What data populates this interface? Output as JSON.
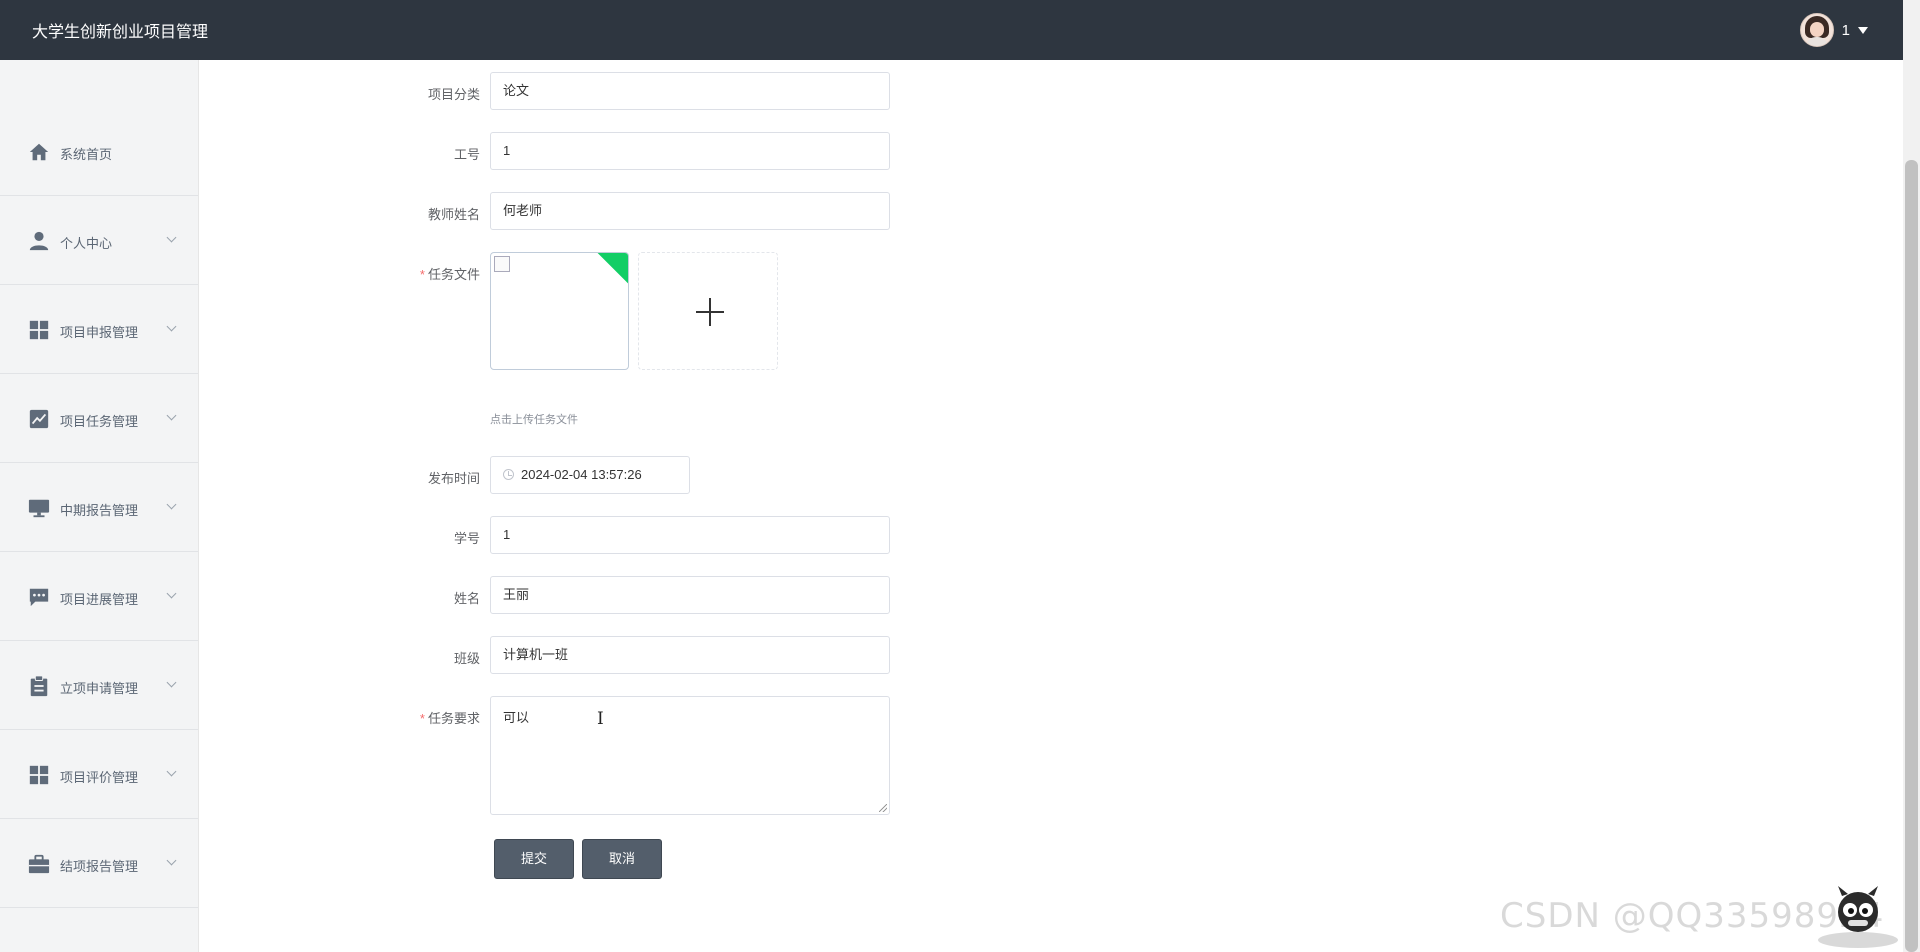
{
  "app": {
    "title": "大学生创新创业项目管理"
  },
  "user": {
    "name": "1"
  },
  "sidebar": {
    "items": [
      {
        "label": "系统首页",
        "icon": "home-icon",
        "has_submenu": false
      },
      {
        "label": "个人中心",
        "icon": "user-icon",
        "has_submenu": true
      },
      {
        "label": "项目申报管理",
        "icon": "grid-icon",
        "has_submenu": true
      },
      {
        "label": "项目任务管理",
        "icon": "chart-line-icon",
        "has_submenu": true
      },
      {
        "label": "中期报告管理",
        "icon": "monitor-icon",
        "has_submenu": true
      },
      {
        "label": "项目进展管理",
        "icon": "chat-icon",
        "has_submenu": true
      },
      {
        "label": "立项申请管理",
        "icon": "clipboard-icon",
        "has_submenu": true
      },
      {
        "label": "项目评价管理",
        "icon": "grid-icon",
        "has_submenu": true
      },
      {
        "label": "结项报告管理",
        "icon": "briefcase-icon",
        "has_submenu": true
      }
    ]
  },
  "form": {
    "category": {
      "label": "项目分类",
      "value": "论文"
    },
    "job_no": {
      "label": "工号",
      "value": "1"
    },
    "teacher_name": {
      "label": "教师姓名",
      "value": "何老师"
    },
    "task_file": {
      "label": "任务文件",
      "required": true,
      "hint": "点击上传任务文件"
    },
    "publish_time": {
      "label": "发布时间",
      "value": "2024-02-04 13:57:26"
    },
    "student_no": {
      "label": "学号",
      "value": "1"
    },
    "name": {
      "label": "姓名",
      "value": "王丽"
    },
    "class": {
      "label": "班级",
      "value": "计算机一班"
    },
    "task_requirement": {
      "label": "任务要求",
      "required": true,
      "value": "可以"
    },
    "submit_label": "提交",
    "cancel_label": "取消"
  },
  "watermark": "CSDN @QQ33598924",
  "colors": {
    "topbar": "#2e3640",
    "button": "#535e6b",
    "upload_success": "#13ce66",
    "required": "#f56c6c"
  }
}
